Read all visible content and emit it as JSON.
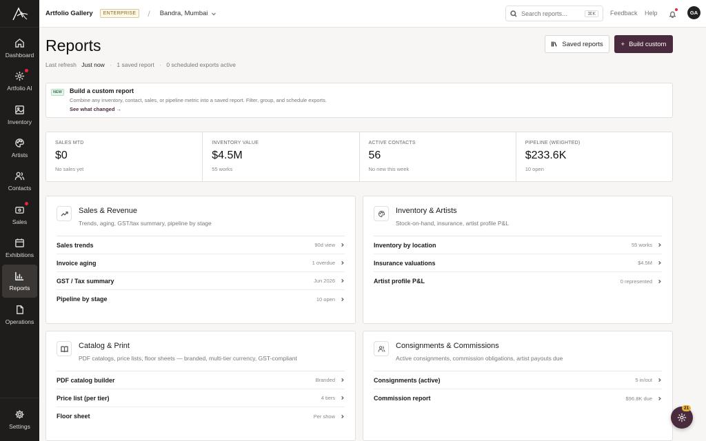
{
  "sidebar": {
    "items": [
      {
        "label": "Dashboard",
        "icon": "home-icon",
        "dot": false,
        "active": false
      },
      {
        "label": "Artfolio AI",
        "icon": "sparkle-icon",
        "dot": true,
        "active": false
      },
      {
        "label": "Inventory",
        "icon": "image-icon",
        "dot": false,
        "active": false
      },
      {
        "label": "Artists",
        "icon": "palette-icon",
        "dot": false,
        "active": false
      },
      {
        "label": "Contacts",
        "icon": "users-icon",
        "dot": false,
        "active": false
      },
      {
        "label": "Sales",
        "icon": "wallet-icon",
        "dot": true,
        "active": false
      },
      {
        "label": "Exhibitions",
        "icon": "calendar-icon",
        "dot": false,
        "active": false
      },
      {
        "label": "Reports",
        "icon": "bar-chart-icon",
        "dot": false,
        "active": true
      },
      {
        "label": "Operations",
        "icon": "document-icon",
        "dot": false,
        "active": false
      }
    ],
    "settings_label": "Settings"
  },
  "topbar": {
    "org": "Artfolio Gallery",
    "plan_badge": "ENTERPRISE",
    "location": "Bandra, Mumbai",
    "search_placeholder": "Search reports...",
    "search_shortcut": "⌘K",
    "feedback": "Feedback",
    "help": "Help",
    "avatar_initials": "GA"
  },
  "header": {
    "title": "Reports",
    "last_refresh_label": "Last refresh",
    "last_refresh_value": "Just now",
    "saved_count": "1 saved report",
    "exports": "0 scheduled exports active",
    "saved_button": "Saved reports",
    "build_button": "Build custom"
  },
  "banner": {
    "tag": "NEW",
    "title": "Build a custom report",
    "desc": "Combine any inventory, contact, sales, or pipeline metric into a saved report. Filter, group, and schedule exports.",
    "link": "See what changed →"
  },
  "kpis": [
    {
      "label": "SALES MTD",
      "value": "$0",
      "sub": "No sales yet"
    },
    {
      "label": "INVENTORY VALUE",
      "value": "$4.5M",
      "sub": "55 works"
    },
    {
      "label": "ACTIVE CONTACTS",
      "value": "56",
      "sub": "No new this week"
    },
    {
      "label": "PIPELINE (WEIGHTED)",
      "value": "$233.6K",
      "sub": "10 open"
    }
  ],
  "cards": [
    {
      "title": "Sales & Revenue",
      "desc": "Trends, aging, GST/tax summary, pipeline by stage",
      "icon": "trending-up-icon",
      "rows": [
        {
          "label": "Sales trends",
          "meta": "90d view"
        },
        {
          "label": "Invoice aging",
          "meta": "1 overdue"
        },
        {
          "label": "GST / Tax summary",
          "meta": "Jun 2026"
        },
        {
          "label": "Pipeline by stage",
          "meta": "10 open"
        }
      ]
    },
    {
      "title": "Inventory & Artists",
      "desc": "Stock-on-hand, insurance, artist profile P&L",
      "icon": "palette-icon",
      "rows": [
        {
          "label": "Inventory by location",
          "meta": "55 works"
        },
        {
          "label": "Insurance valuations",
          "meta": "$4.5M"
        },
        {
          "label": "Artist profile P&L",
          "meta": "0 represented"
        }
      ]
    },
    {
      "title": "Catalog & Print",
      "desc": "PDF catalogs, price lists, floor sheets — branded, multi-tier currency, GST-compliant",
      "icon": "book-icon",
      "rows": [
        {
          "label": "PDF catalog builder",
          "meta": "Branded"
        },
        {
          "label": "Price list (per tier)",
          "meta": "4 tiers"
        },
        {
          "label": "Floor sheet",
          "meta": "Per show"
        }
      ]
    },
    {
      "title": "Consignments & Commissions",
      "desc": "Active consignments, commission obligations, artist payouts due",
      "icon": "users-icon",
      "rows": [
        {
          "label": "Consignments (active)",
          "meta": "5 in/out"
        },
        {
          "label": "Commission report",
          "meta": "$96.8K due"
        }
      ]
    }
  ],
  "fab": {
    "badge": "21",
    "icon": "sparkle-icon"
  },
  "colors": {
    "brand": "#4a2a3d",
    "sidebar": "#1f1d1b",
    "alert": "#e5283b"
  }
}
